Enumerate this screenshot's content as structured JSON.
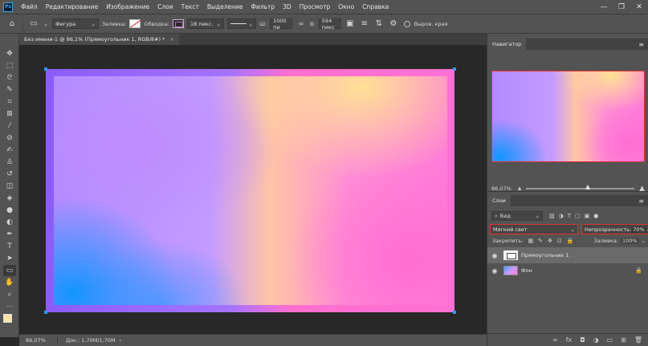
{
  "app": {
    "logo": "Ps"
  },
  "menu": [
    "Файл",
    "Редактирование",
    "Изображение",
    "Слои",
    "Текст",
    "Выделение",
    "Фильтр",
    "3D",
    "Просмотр",
    "Окно",
    "Справка"
  ],
  "window_controls": {
    "minimize": "—",
    "restore": "❐",
    "close": "✕"
  },
  "options": {
    "mode": "Фигура",
    "fill_label": "Заливка:",
    "stroke_label": "Обводка:",
    "stroke_width": "18 пикс.",
    "w_label": "Ш:",
    "w_value": "1000 пи",
    "link_icon": "∞",
    "h_label": "В:",
    "h_value": "594 пикс",
    "smooth_edges": "Выров. края"
  },
  "document_tab": {
    "title": "Без имени-1 @ 86,1% (Прямоугольник 1, RGB/8#) *",
    "close": "×"
  },
  "status": {
    "zoom": "86,07%",
    "doc": "Док.: 1,70M/1,70M",
    "arrow": "›"
  },
  "navigator": {
    "title": "Навигатор",
    "zoom": "86,07%",
    "zoom_level": 0.57
  },
  "layers_panel": {
    "title": "Слои",
    "filter": "Вид",
    "blend_mode": "Мягкий свет",
    "opacity_label": "Непрозрачность:",
    "opacity_value": "70%",
    "lock_label": "Закрепить:",
    "fill_label": "Заливка:",
    "fill_value": "100%",
    "layers": [
      {
        "name": "Прямоугольник 1",
        "selected": true
      },
      {
        "name": "Фон",
        "selected": false
      }
    ]
  },
  "colors": {
    "foreground": "#ffe4a6",
    "background": "#ffffff",
    "accent": "#2a9bff"
  }
}
